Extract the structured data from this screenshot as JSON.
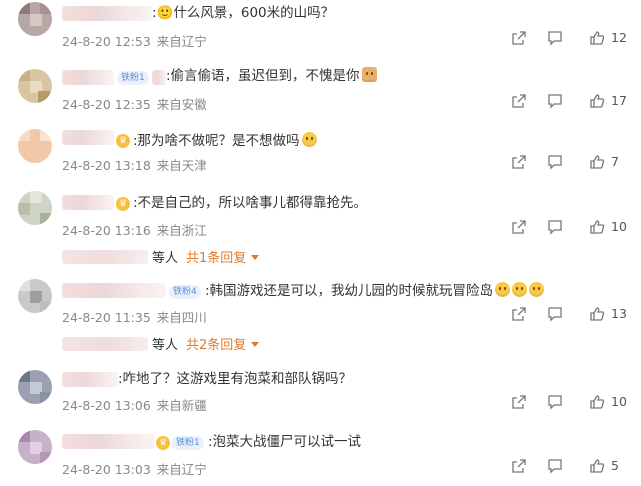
{
  "comments": [
    {
      "text": ":🙂什么风景，600米的山吗？",
      "time": "24-8-20 12:53",
      "location": "来自辽宁",
      "likes": "12"
    },
    {
      "badge": "铁粉1",
      "text": ":偷言偷语，虽迟但到，不愧是你",
      "time": "24-8-20 12:35",
      "location": "来自安徽",
      "likes": "17"
    },
    {
      "text": ":那为啥不做呢？是不想做吗",
      "time": "24-8-20 13:18",
      "location": "来自天津",
      "likes": "7"
    },
    {
      "text": ":不是自己的，所以啥事儿都得靠抢先。",
      "time": "24-8-20 13:16",
      "location": "来自浙江",
      "likes": "10",
      "replies": {
        "who": "等人",
        "more": "共1条回复"
      }
    },
    {
      "badge": "铁粉4",
      "text": ":韩国游戏还是可以，我幼儿园的时候就玩冒险岛",
      "time": "24-8-20 11:35",
      "location": "来自四川",
      "likes": "13",
      "replies": {
        "who": "等人",
        "more": "共2条回复"
      }
    },
    {
      "text": ":咋地了？这游戏里有泡菜和部队锅吗？",
      "time": "24-8-20 13:06",
      "location": "来自新疆",
      "likes": "10"
    },
    {
      "badge": "铁粉1",
      "text": ":泡菜大战僵尸可以试一试",
      "time": "24-8-20 13:03",
      "location": "来自辽宁",
      "likes": "5"
    }
  ],
  "icons": {
    "share": "share-icon",
    "comment": "comment-icon",
    "like": "like-icon"
  },
  "colors": {
    "accent": "#e07b2c",
    "meta": "#888888",
    "badge": "#5a8fd8"
  }
}
